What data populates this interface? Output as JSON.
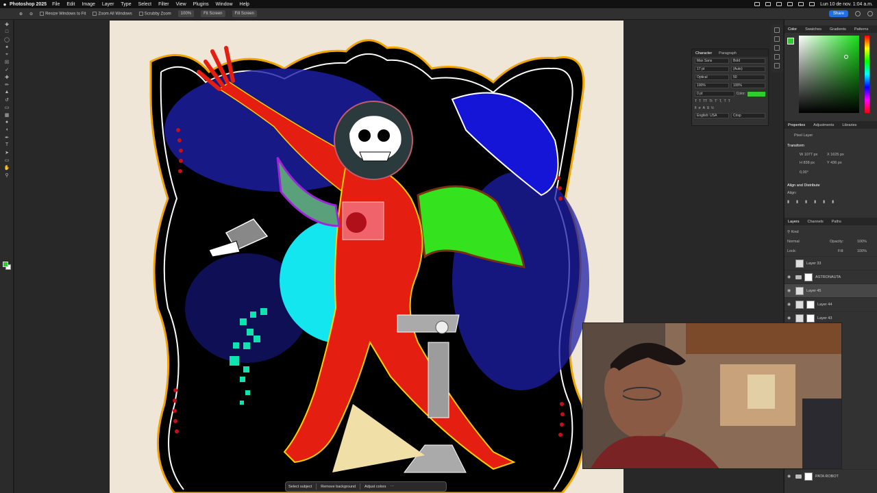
{
  "menubar": {
    "app": "Photoshop 2025",
    "items": [
      "File",
      "Edit",
      "Image",
      "Layer",
      "Type",
      "Select",
      "Filter",
      "View",
      "Plugins",
      "Window",
      "Help"
    ],
    "clock": "Lun 10 de nov.  1:04 a.m."
  },
  "options": {
    "resize": "Resize Windows to Fit",
    "zoom_all": "Zoom All Windows",
    "scrubby": "Scrubby Zoom",
    "percent": "100%",
    "fit": "Fit Screen",
    "fill": "Fill Screen",
    "share": "Share"
  },
  "context_bar": {
    "select_subject": "Select subject",
    "remove_bg": "Remove background",
    "adjust": "Adjust colors"
  },
  "character": {
    "tab1": "Character",
    "tab2": "Paragraph",
    "font": "Max Sans",
    "style": "Bold",
    "size": "17 pt",
    "leading": "(Auto)",
    "kerning": "Optical",
    "tracking": "50",
    "vscale": "100%",
    "hscale": "100%",
    "baseline": "0 pt",
    "color_label": "Color:",
    "language": "English: USA",
    "aa": "Crisp"
  },
  "color": {
    "tabs": [
      "Color",
      "Swatches",
      "Gradients",
      "Patterns"
    ],
    "fg": "#2ecc2e"
  },
  "properties": {
    "tabs": [
      "Properties",
      "Adjustments",
      "Libraries"
    ],
    "kind": "Pixel Layer",
    "transform": "Transform",
    "w": "1077 px",
    "x": "1625 px",
    "h": "838 px",
    "y": "436 px",
    "angle": "0,00°",
    "align": "Align and Distribute",
    "align_sub": "Align:"
  },
  "layers": {
    "tabs": [
      "Layers",
      "Channels",
      "Paths"
    ],
    "kind": "Kind",
    "mode": "Normal",
    "opacity_label": "Opacity:",
    "opacity": "100%",
    "lock_label": "Lock:",
    "fill_label": "Fill:",
    "fill": "100%",
    "rows": [
      "Layer 33",
      "ASTRONAUTA",
      "Layer 45",
      "Layer 44",
      "Layer 43"
    ],
    "bottom": "PATA ROBOT"
  }
}
